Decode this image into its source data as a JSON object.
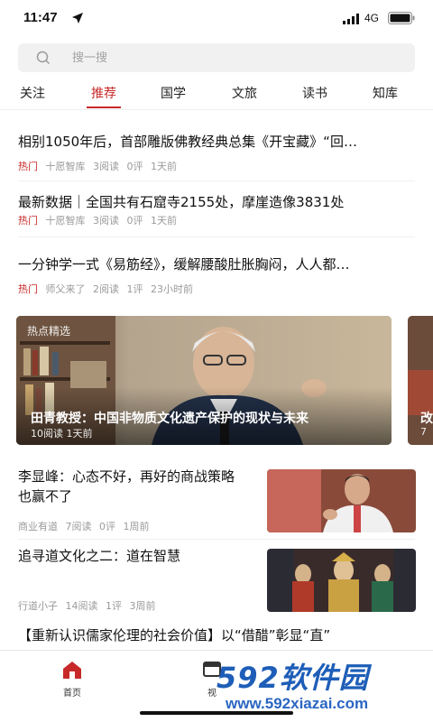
{
  "status": {
    "time": "11:47",
    "network": "4G"
  },
  "search": {
    "placeholder": "搜一搜"
  },
  "tabs": [
    {
      "label": "关注"
    },
    {
      "label": "推荐"
    },
    {
      "label": "国学"
    },
    {
      "label": "文旅"
    },
    {
      "label": "读书"
    },
    {
      "label": "知库"
    }
  ],
  "active_tab": "推荐",
  "accent_color": "#c72929",
  "articles": [
    {
      "title": "相别1050年后，首部雕版佛教经典总集《开宝藏》“回…",
      "tag": "热门",
      "source": "十愿智库",
      "reads": "3阅读",
      "comments": "0评",
      "time": "1天前"
    },
    {
      "title": "最新数据｜全国共有石窟寺2155处，摩崖造像3831处",
      "tag": "热门",
      "source": "十愿智库",
      "reads": "3阅读",
      "comments": "0评",
      "time": "1天前"
    },
    {
      "title": "一分钟学一式《易筋经》，缓解腰酸肚胀胸闷，人人都…",
      "tag": "热门",
      "source": "师父来了",
      "reads": "2阅读",
      "comments": "1评",
      "time": "23小时前"
    }
  ],
  "banner": {
    "tag": "热点精选",
    "title": "田青教授：中国非物质文化遗产保护的现状与未来",
    "reads": "10阅读",
    "time": "1天前",
    "next_title": "改",
    "next_meta": "7"
  },
  "thumb_articles": [
    {
      "title": "李显峰：心态不好，再好的商战策略也赢不了",
      "source": "商业有道",
      "reads": "7阅读",
      "comments": "0评",
      "time": "1周前",
      "image": "man-speaking-microphone"
    },
    {
      "title": "追寻道文化之二：道在智慧",
      "source": "行道小子",
      "reads": "14阅读",
      "comments": "1评",
      "time": "3周前",
      "image": "taoist-deity-statues"
    }
  ],
  "partial_article": {
    "title": "【重新认识儒家伦理的社会价值】以“借醋”彰显“直”"
  },
  "bottom_nav": [
    {
      "label": "首页",
      "icon": "home-icon"
    },
    {
      "label": "视",
      "icon": "video-icon"
    }
  ],
  "watermark": {
    "big": "592软件园",
    "small": "www.592xiazai.com"
  }
}
